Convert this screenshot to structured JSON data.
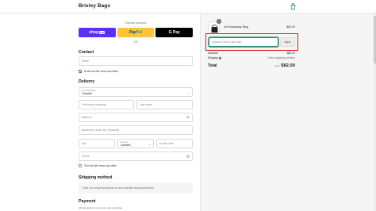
{
  "header": {
    "brand": "Brixley Bags",
    "bag_icon": "shopping-bag-icon"
  },
  "express": {
    "label": "Express checkout",
    "shop_pay": {
      "text": "shop",
      "badge": "Pay"
    },
    "paypal": {
      "pay": "Pay",
      "pal": "Pal"
    },
    "gpay": "G Pay",
    "or": "OR"
  },
  "contact": {
    "title": "Contact",
    "email_placeholder": "Email",
    "email_news_label": "Email me with news and offers"
  },
  "delivery": {
    "title": "Delivery",
    "country_label": "Country/Region",
    "country_value": "Canada",
    "first_name_placeholder": "First name (optional)",
    "last_name_placeholder": "Last name",
    "address_placeholder": "Address",
    "apartment_placeholder": "Apartment, suite, etc. (optional)",
    "city_placeholder": "City",
    "province_label": "Province",
    "province_value": "Quebec",
    "postal_placeholder": "Postal code",
    "phone_placeholder": "Phone",
    "text_news_label": "Text me with news and offers"
  },
  "shipping": {
    "title": "Shipping method",
    "note": "Enter your shipping address to view available shipping methods."
  },
  "payment": {
    "title": "Payment",
    "note": "All transactions are secure and encrypted."
  },
  "cart": {
    "item": {
      "name": "Jet Crossbody Sling",
      "price": "$82.00",
      "quantity": "1"
    },
    "discount_placeholder": "Discount code or gift card",
    "apply_label": "Apply",
    "subtotal_label": "Subtotal",
    "subtotal_value": "$82.00",
    "shipping_label": "Shipping",
    "shipping_value": "Enter shipping address",
    "total_label": "Total",
    "total_currency": "CAD",
    "total_value": "$82.00"
  },
  "colors": {
    "shop_pay": "#5a31f4",
    "paypal": "#ffc439",
    "highlight": "#e0191e",
    "focus": "#2d8a77",
    "checkbox": "#1773b0"
  }
}
